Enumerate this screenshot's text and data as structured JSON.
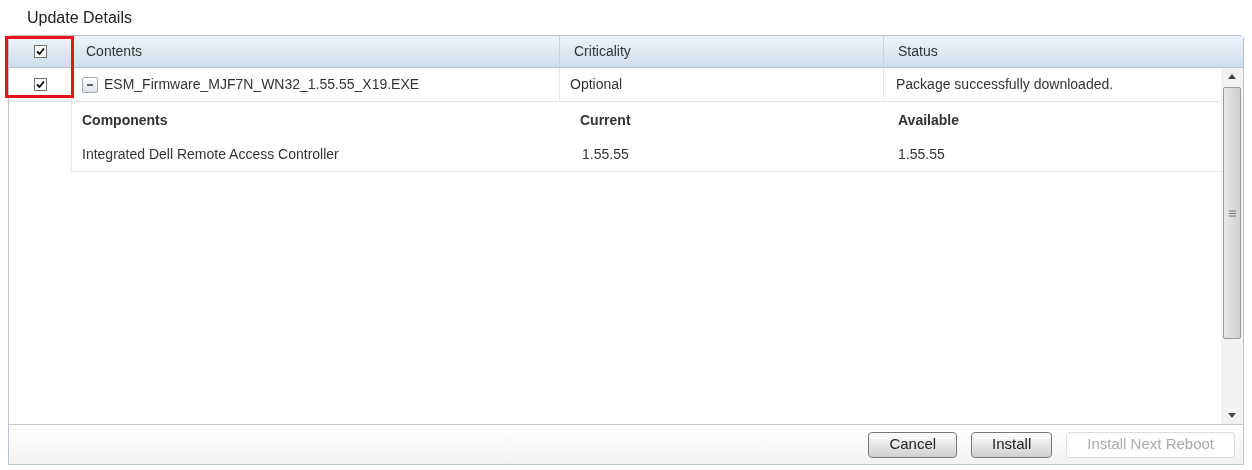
{
  "title": "Update Details",
  "table": {
    "select_all": {
      "checked": true
    },
    "columns": [
      "Contents",
      "Criticality",
      "Status"
    ],
    "rows": [
      {
        "checked": true,
        "expanded": true,
        "contents": "ESM_Firmware_MJF7N_WN32_1.55.55_X19.EXE",
        "criticality": "Optional",
        "status": "Package successfully downloaded.",
        "details": {
          "columns": [
            "Components",
            "Current",
            "Available"
          ],
          "rows": [
            [
              "Integrated Dell Remote Access Controller",
              "1.55.55",
              "1.55.55"
            ]
          ]
        }
      }
    ]
  },
  "buttons": [
    {
      "label": "Cancel",
      "disabled": false
    },
    {
      "label": "Install",
      "disabled": false
    },
    {
      "label": "Install Next Reboot",
      "disabled": true
    }
  ]
}
